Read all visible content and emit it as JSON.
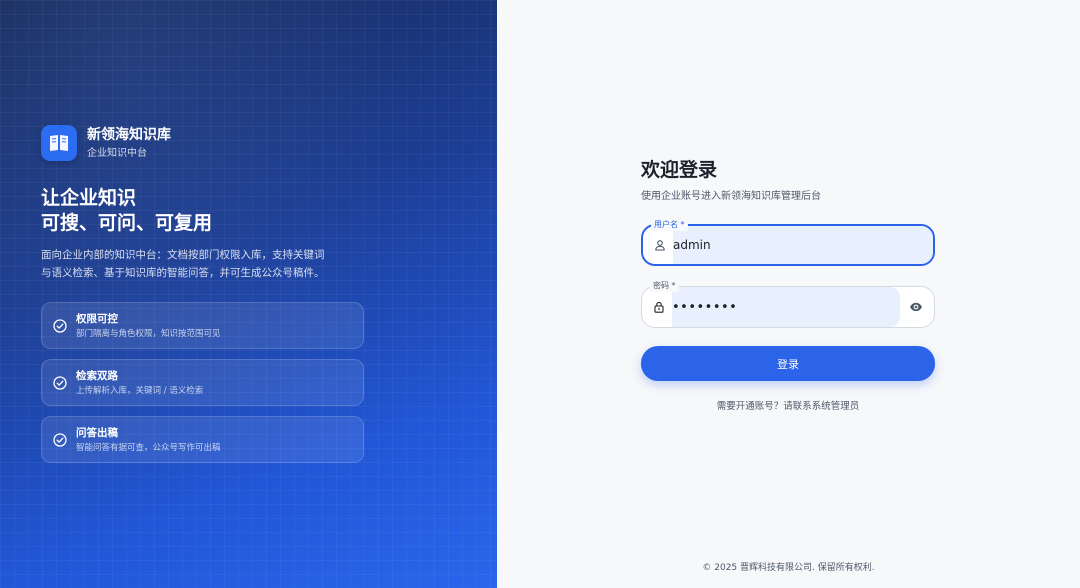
{
  "brand": {
    "name": "新领海知识库",
    "subtitle": "企业知识中台"
  },
  "hero": {
    "headline_line1": "让企业知识",
    "headline_line2": "可搜、可问、可复用",
    "description_line1": "面向企业内部的知识中台：文档按部门权限入库，支持关键词",
    "description_line2": "与语义检索、基于知识库的智能问答，并可生成公众号稿件。"
  },
  "features": [
    {
      "title": "权限可控",
      "desc": "部门隔离与角色权限，知识按范围可见",
      "icon": "check-circle-icon"
    },
    {
      "title": "检索双路",
      "desc": "上传解析入库，关键词 / 语义检索",
      "icon": "check-circle-icon"
    },
    {
      "title": "问答出稿",
      "desc": "智能问答有据可查，公众号写作可出稿",
      "icon": "check-circle-icon"
    }
  ],
  "login": {
    "title": "欢迎登录",
    "subtitle": "使用企业账号进入新领海知识库管理后台",
    "username_label": "用户名 *",
    "username_value": "admin",
    "password_label": "密码 *",
    "password_value": "••••••••",
    "submit_label": "登录",
    "help_text": "需要开通账号？请联系系统管理员"
  },
  "footer": {
    "copyright": "© 2025 晋辉科技有限公司. 保留所有权利."
  },
  "colors": {
    "primary": "#2b63e9",
    "hero_dark": "#172a57",
    "hero_light": "#2966ec",
    "input_fill": "#e9f0fd"
  }
}
